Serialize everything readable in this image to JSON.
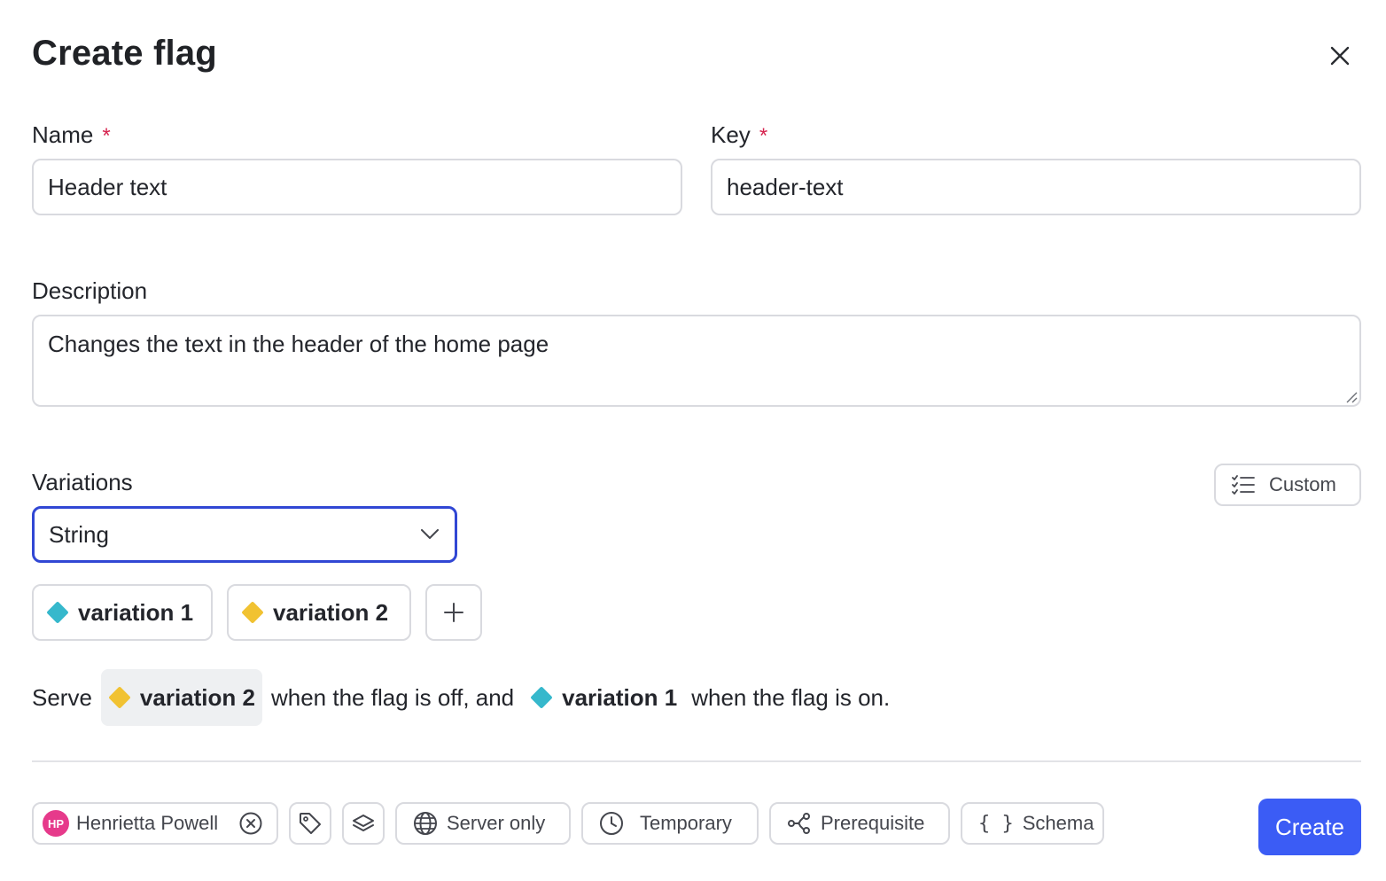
{
  "dialog": {
    "title": "Create flag",
    "close_icon": "close-icon"
  },
  "name_field": {
    "label": "Name",
    "required_mark": "*",
    "value": "Header text"
  },
  "key_field": {
    "label": "Key",
    "required_mark": "*",
    "value": "header-text"
  },
  "description_field": {
    "label": "Description",
    "value": "Changes the text in the header of the home page"
  },
  "variations": {
    "label": "Variations",
    "custom_button": "Custom",
    "type_select": "String",
    "items": [
      {
        "label": "variation 1",
        "color": "#36b8cc"
      },
      {
        "label": "variation 2",
        "color": "#f1c232"
      }
    ]
  },
  "serve_sentence": {
    "prefix": "Serve",
    "off_variation": "variation 2",
    "middle": "when the flag is off, and",
    "on_variation": "variation 1",
    "suffix": "when the flag is on."
  },
  "footer": {
    "maintainer": {
      "initials": "HP",
      "name": "Henrietta Powell"
    },
    "server_only": "Server only",
    "temporary": "Temporary",
    "prerequisite": "Prerequisite",
    "schema": "Schema",
    "schema_glyph": "{ }",
    "create_button": "Create"
  },
  "colors": {
    "accent": "#3b5cf5",
    "select_focus": "#3147d4",
    "required": "#d6244f",
    "avatar": "#e63a8b"
  }
}
